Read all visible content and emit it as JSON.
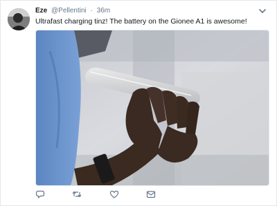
{
  "tweet": {
    "author_name": "Eze",
    "author_handle": "@Pellentini",
    "separator": "·",
    "time": "36m",
    "text": "Ultrafast charging tinz! The battery on the Gionee A1 is awesome!",
    "media_alt": "Hand holding a Gionee A1 smartphone",
    "actions": {
      "reply_icon": "reply-icon",
      "retweet_icon": "retweet-icon",
      "like_icon": "heart-icon",
      "dm_icon": "mail-icon"
    }
  },
  "colors": {
    "secondary_text": "#657786",
    "icon": "#657786",
    "border": "#e1e8ed"
  }
}
